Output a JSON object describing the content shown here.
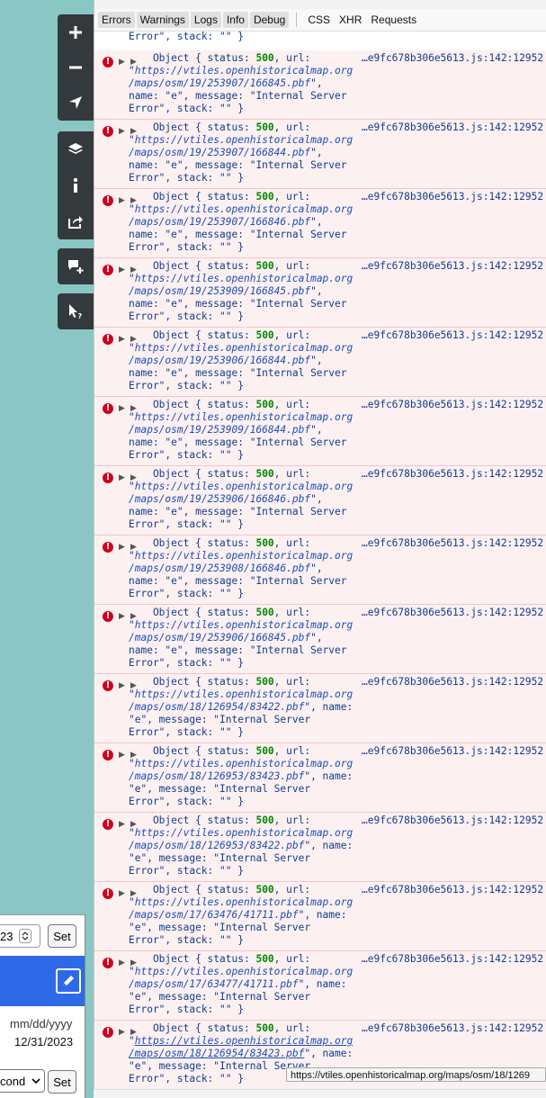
{
  "toolbar": {
    "filters": [
      "Errors",
      "Warnings",
      "Logs",
      "Info",
      "Debug"
    ],
    "types": [
      "CSS",
      "XHR",
      "Requests"
    ]
  },
  "fragment": {
    "line": "Error\", stack: \"\" }"
  },
  "log": {
    "source": "…e9fc678b306e5613.js:142:12952",
    "entries": [
      {
        "url": "https://vtiles.openhistoricalmap.org/maps/osm/19/253907/166845.pbf",
        "l1": "Object { status: 500, url:",
        "l2": "\"https://vtiles.openhistoricalmap.org",
        "l3": "/maps/osm/19/253907/166845.pbf\",",
        "l4": "name: \"e\", message: \"Internal Server",
        "l5": "Error\", stack: \"\" }"
      },
      {
        "l1": "Object { status: 500, url:",
        "l2": "\"https://vtiles.openhistoricalmap.org",
        "l3": "/maps/osm/19/253907/166844.pbf\",",
        "l4": "name: \"e\", message: \"Internal Server",
        "l5": "Error\", stack: \"\" }"
      },
      {
        "l1": "Object { status: 500, url:",
        "l2": "\"https://vtiles.openhistoricalmap.org",
        "l3": "/maps/osm/19/253907/166846.pbf\",",
        "l4": "name: \"e\", message: \"Internal Server",
        "l5": "Error\", stack: \"\" }"
      },
      {
        "l1": "Object { status: 500, url:",
        "l2": "\"https://vtiles.openhistoricalmap.org",
        "l3": "/maps/osm/19/253909/166845.pbf\",",
        "l4": "name: \"e\", message: \"Internal Server",
        "l5": "Error\", stack: \"\" }"
      },
      {
        "l1": "Object { status: 500, url:",
        "l2": "\"https://vtiles.openhistoricalmap.org",
        "l3": "/maps/osm/19/253906/166844.pbf\",",
        "l4": "name: \"e\", message: \"Internal Server",
        "l5": "Error\", stack: \"\" }"
      },
      {
        "l1": "Object { status: 500, url:",
        "l2": "\"https://vtiles.openhistoricalmap.org",
        "l3": "/maps/osm/19/253909/166844.pbf\",",
        "l4": "name: \"e\", message: \"Internal Server",
        "l5": "Error\", stack: \"\" }"
      },
      {
        "l1": "Object { status: 500, url:",
        "l2": "\"https://vtiles.openhistoricalmap.org",
        "l3": "/maps/osm/19/253906/166846.pbf\",",
        "l4": "name: \"e\", message: \"Internal Server",
        "l5": "Error\", stack: \"\" }"
      },
      {
        "l1": "Object { status: 500, url:",
        "l2": "\"https://vtiles.openhistoricalmap.org",
        "l3": "/maps/osm/19/253908/166846.pbf\",",
        "l4": "name: \"e\", message: \"Internal Server",
        "l5": "Error\", stack: \"\" }"
      },
      {
        "l1": "Object { status: 500, url:",
        "l2": "\"https://vtiles.openhistoricalmap.org",
        "l3": "/maps/osm/19/253906/166845.pbf\",",
        "l4": "name: \"e\", message: \"Internal Server",
        "l5": "Error\", stack: \"\" }"
      },
      {
        "l1": "Object { status: 500, url:",
        "l2": "\"https://vtiles.openhistoricalmap.org",
        "l3": "/maps/osm/18/126954/83422.pbf\", name:",
        "l4": "\"e\", message: \"Internal Server",
        "l5": "Error\", stack: \"\" }"
      },
      {
        "l1": "Object { status: 500, url:",
        "l2": "\"https://vtiles.openhistoricalmap.org",
        "l3": "/maps/osm/18/126953/83423.pbf\", name:",
        "l4": "\"e\", message: \"Internal Server",
        "l5": "Error\", stack: \"\" }"
      },
      {
        "l1": "Object { status: 500, url:",
        "l2": "\"https://vtiles.openhistoricalmap.org",
        "l3": "/maps/osm/18/126953/83422.pbf\", name:",
        "l4": "\"e\", message: \"Internal Server",
        "l5": "Error\", stack: \"\" }"
      },
      {
        "l1": "Object { status: 500, url:",
        "l2": "\"https://vtiles.openhistoricalmap.org",
        "l3": "/maps/osm/17/63476/41711.pbf\", name:",
        "l4": "\"e\", message: \"Internal Server",
        "l5": "Error\", stack: \"\" }"
      },
      {
        "l1": "Object { status: 500, url:",
        "l2": "\"https://vtiles.openhistoricalmap.org",
        "l3": "/maps/osm/17/63477/41711.pbf\", name:",
        "l4": "\"e\", message: \"Internal Server",
        "l5": "Error\", stack: \"\" }"
      },
      {
        "l1": "Object { status: 500, url:",
        "l2": "\"https://vtiles.openhistoricalmap.org",
        "l3": "/maps/osm/18/126954/83423.pbf\", name:",
        "l4": "\"e\", message: \"Internal Server",
        "l5": "Error\", stack: \"\" }"
      }
    ]
  },
  "tooltip": {
    "text": "https://vtiles.openhistoricalmap.org/maps/osm/18/1269"
  },
  "panel": {
    "date_value": "23",
    "set_label": "Set",
    "date_placeholder": "mm/dd/yyyy",
    "date_end": "12/31/2023",
    "unit_select": "cond",
    "set_label_2": "Set"
  },
  "colors": {
    "accent": "#2e6ae8",
    "error": "#d0021b",
    "map": "#8ac6c4"
  }
}
